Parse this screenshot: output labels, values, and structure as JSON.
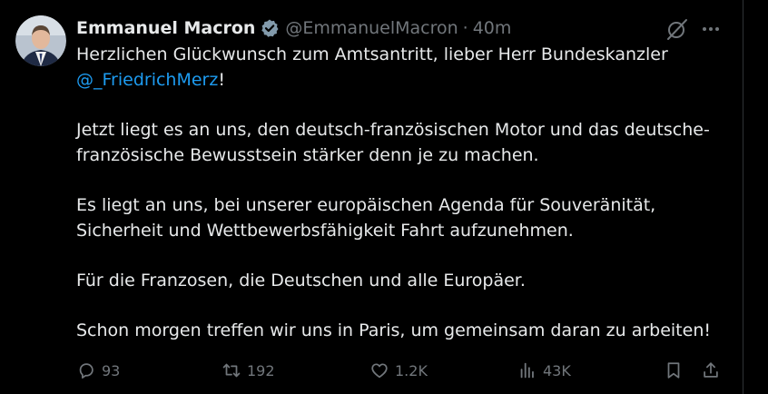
{
  "tweet": {
    "author": {
      "name": "Emmanuel Macron",
      "handle": "@EmmanuelMacron",
      "time": "40m"
    },
    "text": {
      "line1_prefix": "Herzlichen Glückwunsch zum Amtsantritt, lieber Herr Bundeskanzler",
      "mention": "@_FriedrichMerz",
      "mention_suffix": "!",
      "para2": "Jetzt liegt es an uns, den deutsch-französischen Motor und das deutsche-französische Bewusstsein stärker denn je zu machen.",
      "para3": "Es liegt an uns, bei unserer europäischen Agenda für Souveränität, Sicherheit und Wettbewerbsfähigkeit Fahrt aufzunehmen.",
      "para4": "Für die Franzosen, die Deutschen und alle Europäer.",
      "para5": "Schon morgen treffen wir uns in Paris, um gemeinsam daran zu arbeiten!"
    },
    "actions": {
      "replies": "93",
      "reposts": "192",
      "likes": "1.2K",
      "views": "43K"
    }
  },
  "colors": {
    "background": "#000000",
    "text": "#e7e9ea",
    "muted": "#71767b",
    "accent": "#1d9bf0",
    "border": "#2f3336"
  },
  "icons": [
    "verified-badge-icon",
    "grok-icon",
    "more-icon",
    "reply-icon",
    "repost-icon",
    "like-icon",
    "views-icon",
    "bookmark-icon",
    "share-icon"
  ]
}
